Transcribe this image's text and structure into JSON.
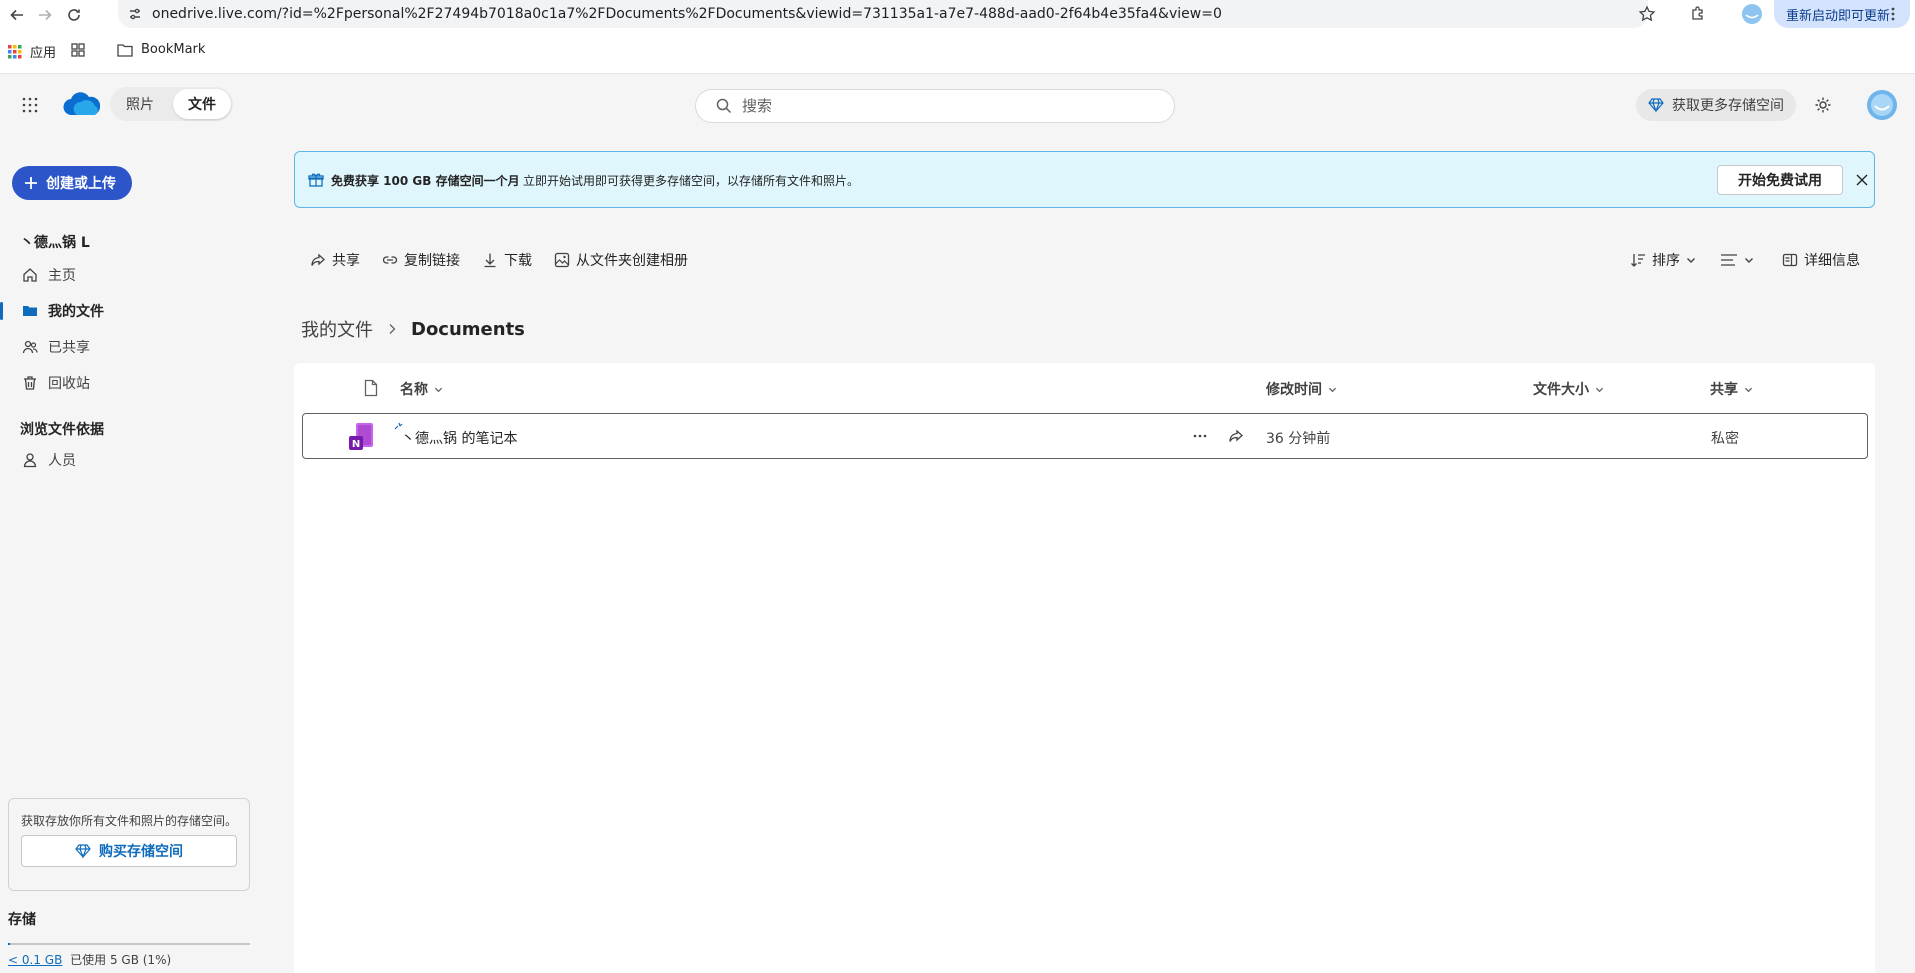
{
  "browser": {
    "url": "onedrive.live.com/?id=%2Fpersonal%2F27494b7018a0c1a7%2FDocuments%2FDocuments&viewid=731135a1-a7e7-488d-aad0-2f64b4e35fa4&view=0",
    "update_label": "重新启动即可更新",
    "bookmarks": {
      "apps": "应用",
      "bookmark": "BookMark"
    }
  },
  "header": {
    "tabs": {
      "photos": "照片",
      "files": "文件"
    },
    "search_placeholder": "搜索",
    "storage_button": "获取更多存储空间"
  },
  "sidebar": {
    "create_button": "创建或上传",
    "account_name": "丶德灬锅 L",
    "items": [
      {
        "label": "主页",
        "icon": "home-icon"
      },
      {
        "label": "我的文件",
        "icon": "folder-icon"
      },
      {
        "label": "已共享",
        "icon": "people-icon"
      },
      {
        "label": "回收站",
        "icon": "trash-icon"
      }
    ],
    "browse_by": "浏览文件依据",
    "browse_items": [
      {
        "label": "人员",
        "icon": "person-icon"
      }
    ],
    "storage_card": {
      "desc": "获取存放你所有文件和照片的存储空间。",
      "buy_button": "购买存储空间"
    },
    "storage": {
      "label": "存储",
      "used_link": "< 0.1 GB",
      "used_text": "已使用 5 GB (1%)",
      "percent": 1
    }
  },
  "banner": {
    "title": "免费获享 100 GB 存储空间一个月",
    "message": "立即开始试用即可获得更多存储空间，以存储所有文件和照片。",
    "trial_button": "开始免费试用"
  },
  "commands": {
    "share": "共享",
    "copy_link": "复制链接",
    "download": "下载",
    "create_album": "从文件夹创建相册",
    "sort": "排序",
    "details": "详细信息"
  },
  "breadcrumb": {
    "root": "我的文件",
    "current": "Documents"
  },
  "table": {
    "columns": {
      "name": "名称",
      "modified": "修改时间",
      "size": "文件大小",
      "sharing": "共享"
    },
    "rows": [
      {
        "name": "丶德灬锅 的笔记本",
        "modified": "36 分钟前",
        "size": "",
        "sharing": "私密"
      }
    ]
  },
  "colors": {
    "accent": "#0f6cbd",
    "create_button": "#2b55c8",
    "banner_bg": "#dff6fd",
    "onenote": "#7719aa"
  }
}
